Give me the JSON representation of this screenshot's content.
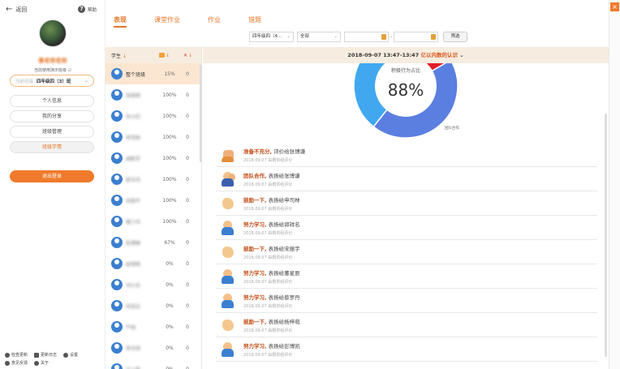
{
  "sidebar": {
    "back_label": "返回",
    "help_label": "帮助",
    "username": "蔡老师老师",
    "note": "当前使用演示班级",
    "class_select": {
      "label": "当前班级",
      "value": "四年级四（3）班"
    },
    "menu": [
      "个人信息",
      "我的分享",
      "班级管理",
      "班级学情"
    ],
    "logout_label": "退出登录",
    "footer": [
      [
        "检查更新",
        "更新日志",
        "设置"
      ],
      [
        "意见反馈",
        "关于"
      ]
    ]
  },
  "tabs": [
    "表现",
    "课堂作业",
    "作业",
    "错题"
  ],
  "filters": {
    "class_value": "四年级四（4...",
    "scope_value": "全部",
    "search_label": "筛选"
  },
  "students_header": {
    "student": "学生",
    "sort_arrow": "↓"
  },
  "students": [
    {
      "name": "整个班级",
      "pct": "15%",
      "cnt": "0",
      "group": true,
      "blur": false
    },
    {
      "name": "张晓明",
      "pct": "100%",
      "cnt": "0",
      "group": false,
      "blur": true
    },
    {
      "name": "孙小红",
      "pct": "100%",
      "cnt": "0",
      "group": false,
      "blur": true
    },
    {
      "name": "申司林",
      "pct": "100%",
      "cnt": "0",
      "group": false,
      "blur": true
    },
    {
      "name": "胡新军",
      "pct": "100%",
      "cnt": "0",
      "group": false,
      "blur": true
    },
    {
      "name": "郭玉丹",
      "pct": "100%",
      "cnt": "0",
      "group": false,
      "blur": true
    },
    {
      "name": "宋丽平",
      "pct": "100%",
      "cnt": "0",
      "group": false,
      "blur": true
    },
    {
      "name": "蔡少丹",
      "pct": "100%",
      "cnt": "0",
      "group": false,
      "blur": true
    },
    {
      "name": "彭博锋",
      "pct": "67%",
      "cnt": "0",
      "group": false,
      "blur": true
    },
    {
      "name": "赵明明",
      "pct": "0%",
      "cnt": "0",
      "group": false,
      "blur": true
    },
    {
      "name": "刘小达",
      "pct": "0%",
      "cnt": "0",
      "group": false,
      "blur": true
    },
    {
      "name": "何志达",
      "pct": "0%",
      "cnt": "0",
      "group": false,
      "blur": true
    },
    {
      "name": "严明",
      "pct": "0%",
      "cnt": "0",
      "group": false,
      "blur": true
    },
    {
      "name": "李华然",
      "pct": "0%",
      "cnt": "0",
      "group": false,
      "blur": true
    },
    {
      "name": "王小磊",
      "pct": "0%",
      "cnt": "0",
      "group": false,
      "blur": true
    }
  ],
  "banner": {
    "date": "2018-09-07 13:47-13:47",
    "highlight": "亿以内数的认识"
  },
  "chart_data": {
    "type": "pie",
    "title": "积极行为占比",
    "center_value": "88%",
    "slices": [
      {
        "name": "团队合作",
        "value": 44,
        "color": "#5a7fe0"
      },
      {
        "name": "鼓励一下",
        "value": 44,
        "color": "#41a8f0"
      },
      {
        "name": "准备不充分",
        "value": 12,
        "color": "#e01e2a"
      }
    ]
  },
  "feed": [
    {
      "icon": "hand",
      "title": "准备不充分,",
      "who": "评价给张博谦",
      "sub": "2018.09.07 由概供组评价"
    },
    {
      "icon": "team",
      "title": "团队合作,",
      "who": "表扬给张博谦",
      "sub": "2018.09.07 由概供组评价"
    },
    {
      "icon": "clap",
      "title": "鼓励一下,",
      "who": "表扬给申司林",
      "sub": "2018.09.07 由概供组评价"
    },
    {
      "icon": "study",
      "title": "努力学习,",
      "who": "表扬给郭祥名",
      "sub": "2018.09.07 由概供组评价"
    },
    {
      "icon": "clap",
      "title": "鼓励一下,",
      "who": "表扬给宋振宇",
      "sub": "2018.09.07 由概供组评价"
    },
    {
      "icon": "study",
      "title": "努力学习,",
      "who": "表扬给董星辰",
      "sub": "2018.09.07 由概供组评价"
    },
    {
      "icon": "study",
      "title": "努力学习,",
      "who": "表扬给蔡罗丹",
      "sub": "2018.09.07 由概供组评价"
    },
    {
      "icon": "clap",
      "title": "鼓励一下,",
      "who": "表扬给杨梓萌",
      "sub": "2018.09.07 由概供组评价"
    },
    {
      "icon": "study",
      "title": "努力学习,",
      "who": "表扬给彭博凯",
      "sub": "2018.09.07 由概供组评价"
    }
  ]
}
